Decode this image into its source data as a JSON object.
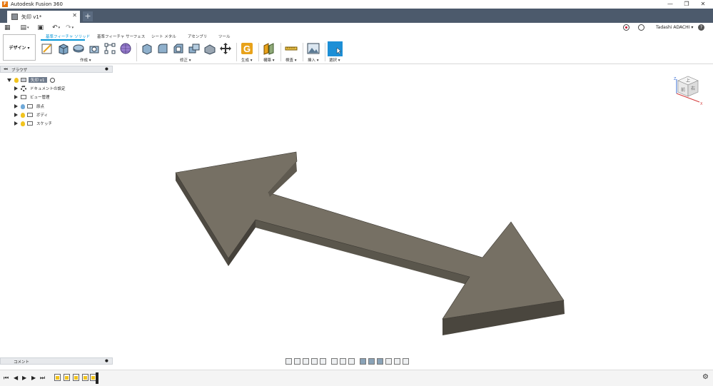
{
  "app": {
    "title": "Autodesk Fusion 360",
    "logo_letter": "F"
  },
  "window_controls": {
    "minimize": "—",
    "restore": "❐",
    "close": "✕"
  },
  "document_tab": {
    "name": "矢印 v1*",
    "close": "✕",
    "new_tab": "+"
  },
  "qat": {
    "grid": "▦",
    "file": "▤",
    "save": "▣",
    "undo": "↶",
    "redo": "↷",
    "dropdown": "▾"
  },
  "user": {
    "name": "Tadashi ADACHI ▾",
    "help": "?"
  },
  "ribbon": {
    "workspace": "デザイン ▾",
    "tabs": [
      "基準フィーチャ ソリッド",
      "基準フィーチャ サーフェス",
      "シート メタル",
      "アセンブリ",
      "ツール"
    ],
    "groups": [
      "作成 ▾",
      "修正 ▾",
      "生成 ▾",
      "構築 ▾",
      "検査 ▾",
      "挿入 ▾",
      "選択 ▾"
    ]
  },
  "browser": {
    "title": "ブラウザ",
    "collapse": "◂◂",
    "pin": "●",
    "root": "矢印 v1",
    "items": [
      "ドキュメントの設定",
      "ビュー管理",
      "原点",
      "ボディ",
      "スケッチ"
    ]
  },
  "viewcube": {
    "top": "上",
    "front": "前",
    "right": "右",
    "axis_x": "X",
    "axis_z": "Z"
  },
  "comment": {
    "label": "コメント",
    "pin": "●"
  },
  "timeline": {
    "first": "⏮",
    "prev": "◀",
    "play": "▶",
    "next": "▶",
    "last": "⏭",
    "settings": "⚙"
  },
  "colors": {
    "tabbar": "#4c5a6c",
    "accent": "#0696d7",
    "model_top": "#756f63",
    "model_side": "#5d584e",
    "model_front": "#504c43"
  }
}
